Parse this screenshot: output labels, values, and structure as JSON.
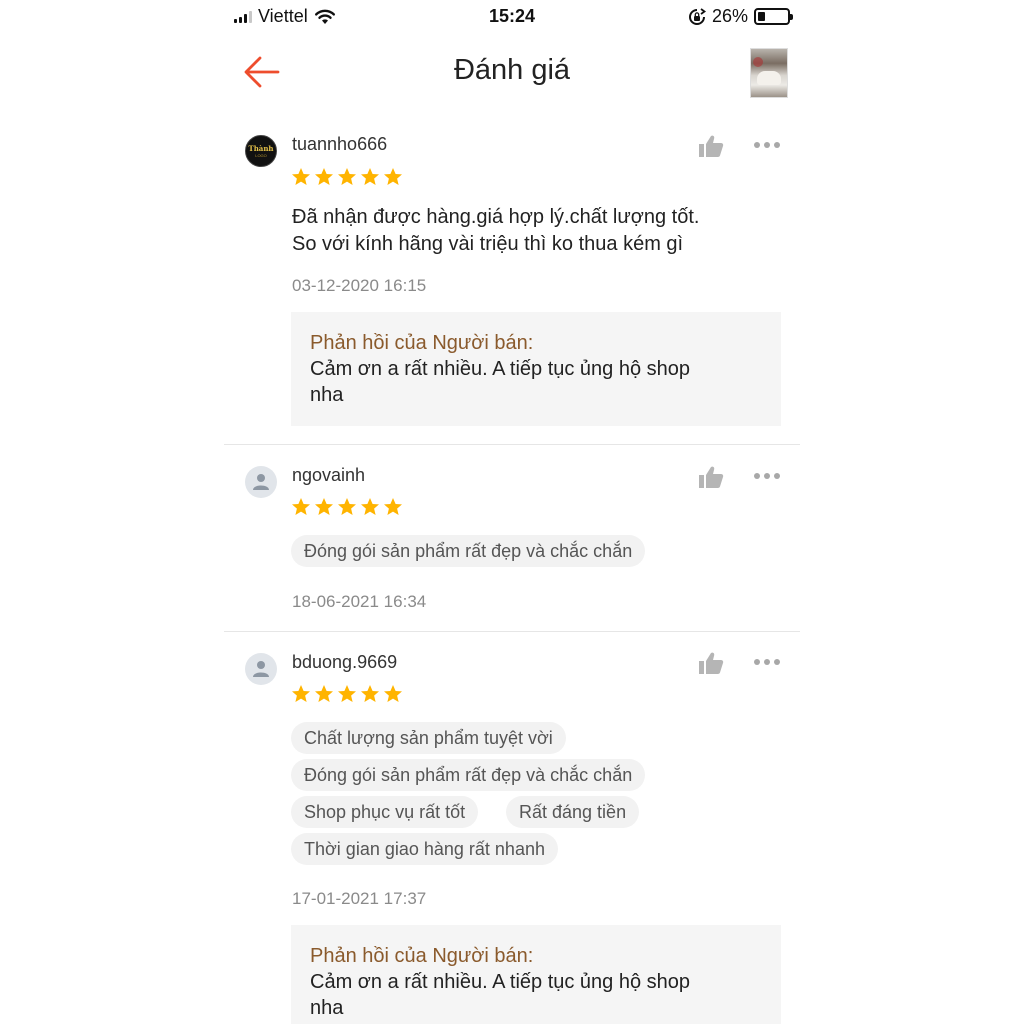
{
  "status_bar": {
    "carrier": "Viettel",
    "time": "15:24",
    "battery_percent": "26%",
    "battery_level": 0.26
  },
  "nav": {
    "title": "Đánh giá",
    "back_icon": "arrow-left-icon",
    "accent": "#ee4d2d"
  },
  "colors": {
    "star": "#ffb400",
    "reply_title": "#8a5a2c",
    "date": "#8a8a8a"
  },
  "reviews": [
    {
      "username": "tuannho666",
      "rating": 5,
      "avatar_text": "Thành",
      "avatar_sub": "LOGO",
      "comment_lines": [
        "Đã nhận được hàng.giá hợp lý.chất lượng tốt.",
        "So với kính hãng vài triệu thì ko thua kém gì"
      ],
      "date": "03-12-2020 16:15",
      "reply": {
        "title": "Phản hồi của Người bán:",
        "lines": [
          "Cảm ơn a rất nhiều. A tiếp tục ủng hộ shop",
          "nha"
        ]
      }
    },
    {
      "username": "ngovainh",
      "rating": 5,
      "tags": [
        "Đóng gói sản phẩm rất đẹp và chắc chắn"
      ],
      "date": "18-06-2021 16:34"
    },
    {
      "username": "bduong.9669",
      "rating": 5,
      "tags": [
        "Chất lượng sản phẩm tuyệt vời",
        "Đóng gói sản phẩm rất đẹp và chắc chắn",
        "Shop phục vụ rất tốt",
        "Rất đáng tiền",
        "Thời gian giao hàng rất nhanh"
      ],
      "date": "17-01-2021 17:37",
      "reply": {
        "title": "Phản hồi của Người bán:",
        "lines": [
          "Cảm ơn a rất nhiều. A tiếp tục ủng hộ shop",
          "nha"
        ]
      }
    }
  ]
}
